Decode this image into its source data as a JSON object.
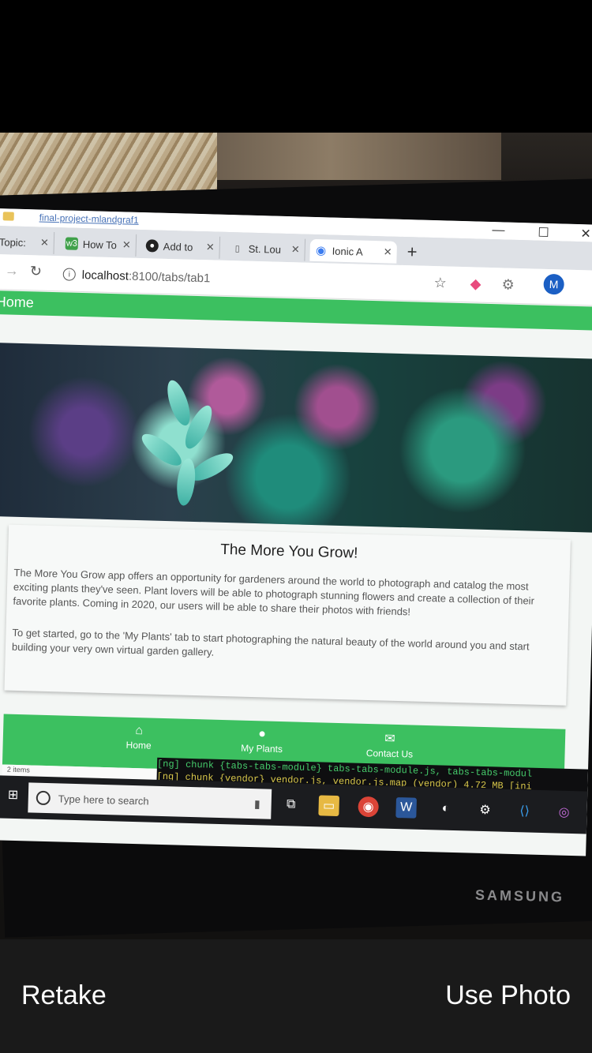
{
  "browser": {
    "window_title": "final-project-mlandgraf1",
    "tabs": [
      {
        "label": "Topic:",
        "icon": "github-icon"
      },
      {
        "label": "How To",
        "icon": "w3-icon"
      },
      {
        "label": "Add to",
        "icon": "octocat-icon"
      },
      {
        "label": "St. Lou",
        "icon": "doc-icon"
      },
      {
        "label": "Ionic A",
        "icon": "ionic-icon",
        "active": true
      }
    ],
    "url_host": "localhost",
    "url_path": ":8100/tabs/tab1",
    "profile_initial": "M"
  },
  "app": {
    "header_title": "Home",
    "card_title": "The More You Grow!",
    "card_para1": "The More You Grow app offers an opportunity for gardeners around the world to photograph and catalog the most exciting plants they've seen. Plant lovers will be able to photograph stunning flowers and create a collection of their favorite plants. Coming in 2020, our users will be able to share their photos with friends!",
    "card_para2": "To get started, go to the 'My Plants' tab to start photographing the natural beauty of the world around you and start building your very own virtual garden gallery.",
    "tabs": [
      {
        "label": "Home",
        "icon": "home-icon"
      },
      {
        "label": "My Plants",
        "icon": "leaf-icon"
      },
      {
        "label": "Contact Us",
        "icon": "mail-icon"
      }
    ],
    "accent_color": "#3cc060"
  },
  "explorer_status": "2 items",
  "terminal": {
    "line1": "[ng] chunk {tabs-tabs-module} tabs-tabs-module.js, tabs-tabs-modul",
    "line2": "[ng] chunk {vendor} vendor.js, vendor.js.map (vendor) 4.72 MB [ini"
  },
  "taskbar": {
    "search_placeholder": "Type here to search"
  },
  "monitor_brand": "SAMSUNG",
  "camera": {
    "retake_label": "Retake",
    "use_photo_label": "Use Photo"
  }
}
